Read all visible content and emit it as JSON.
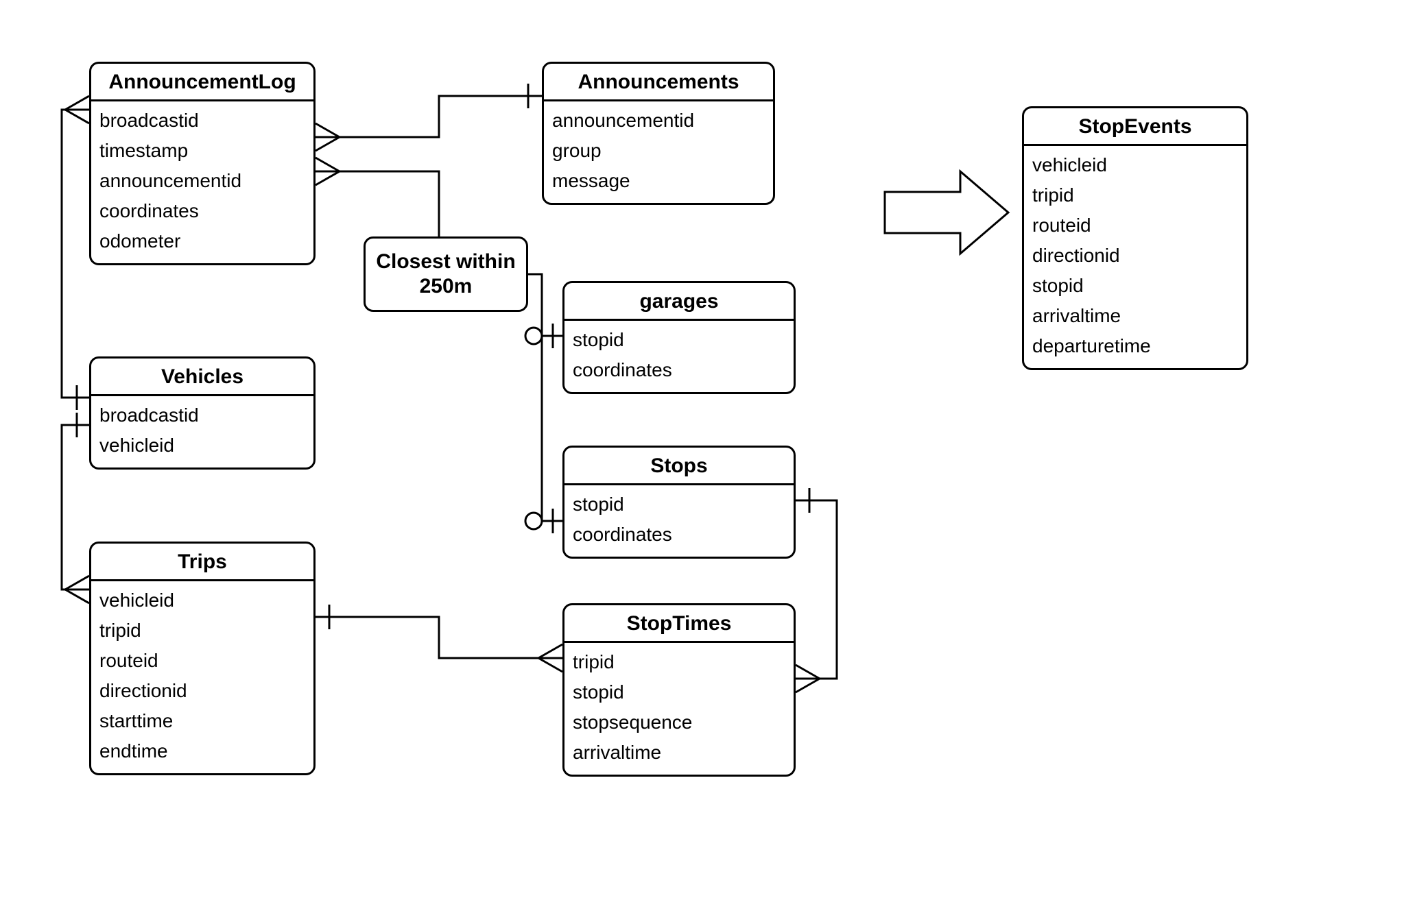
{
  "relationship": {
    "label_line1": "Closest within",
    "label_line2": "250m"
  },
  "entities": {
    "announcementLog": {
      "title": "AnnouncementLog",
      "attrs": [
        "broadcastid",
        "timestamp",
        "announcementid",
        "coordinates",
        "odometer"
      ]
    },
    "announcements": {
      "title": "Announcements",
      "attrs": [
        "announcementid",
        "group",
        "message"
      ]
    },
    "stopEvents": {
      "title": "StopEvents",
      "attrs": [
        "vehicleid",
        "tripid",
        "routeid",
        "directionid",
        "stopid",
        "arrivaltime",
        "departuretime"
      ]
    },
    "vehicles": {
      "title": "Vehicles",
      "attrs": [
        "broadcastid",
        "vehicleid"
      ]
    },
    "trips": {
      "title": "Trips",
      "attrs": [
        "vehicleid",
        "tripid",
        "routeid",
        "directionid",
        "starttime",
        "endtime"
      ]
    },
    "garages": {
      "title": "garages",
      "attrs": [
        "stopid",
        "coordinates"
      ]
    },
    "stops": {
      "title": "Stops",
      "attrs": [
        "stopid",
        "coordinates"
      ]
    },
    "stopTimes": {
      "title": "StopTimes",
      "attrs": [
        "tripid",
        "stopid",
        "stopsequence",
        "arrivaltime"
      ]
    }
  }
}
